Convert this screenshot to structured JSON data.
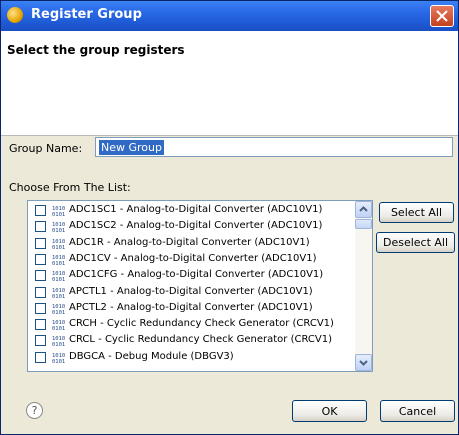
{
  "window": {
    "title": "Register Group",
    "header": "Select the group registers"
  },
  "group_name": {
    "label": "Group Name:",
    "value": "New Group"
  },
  "list": {
    "label": "Choose From The List:",
    "items": [
      {
        "label": "ADC1SC1 - Analog-to-Digital Converter (ADC10V1)",
        "checked": false
      },
      {
        "label": "ADC1SC2 - Analog-to-Digital Converter (ADC10V1)",
        "checked": false
      },
      {
        "label": "ADC1R - Analog-to-Digital Converter (ADC10V1)",
        "checked": false
      },
      {
        "label": "ADC1CV - Analog-to-Digital Converter (ADC10V1)",
        "checked": false
      },
      {
        "label": "ADC1CFG - Analog-to-Digital Converter (ADC10V1)",
        "checked": false
      },
      {
        "label": "APCTL1 - Analog-to-Digital Converter (ADC10V1)",
        "checked": false
      },
      {
        "label": "APCTL2 - Analog-to-Digital Converter (ADC10V1)",
        "checked": false
      },
      {
        "label": "CRCH - Cyclic Redundancy Check Generator (CRCV1)",
        "checked": false
      },
      {
        "label": "CRCL - Cyclic Redundancy Check Generator (CRCV1)",
        "checked": false
      },
      {
        "label": "DBGCA - Debug Module (DBGV3)",
        "checked": false
      }
    ]
  },
  "buttons": {
    "select_all": "Select All",
    "deselect_all": "Deselect All",
    "ok": "OK",
    "cancel": "Cancel",
    "help": "?"
  }
}
